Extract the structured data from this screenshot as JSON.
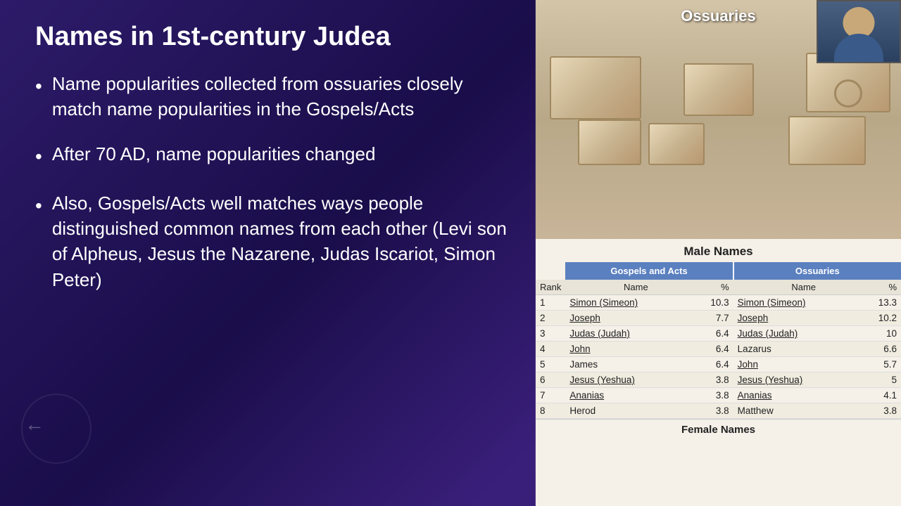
{
  "title": "Names in 1st-century Judea",
  "bullets": [
    "Name popularities collected from ossuaries closely match name popularities in the Gospels/Acts",
    "After 70 AD, name popularities changed",
    "Also, Gospels/Acts well matches ways people distinguished common names from each other (Levi son of Alpheus, Jesus the Nazarene, Judas Iscariot, Simon Peter)"
  ],
  "right": {
    "ossuaries_label": "Ossuaries",
    "table_title": "Male Names",
    "col_headers": {
      "gospels": "Gospels and Acts",
      "ossuaries": "Ossuaries"
    },
    "sub_headers": {
      "rank": "Rank",
      "name1": "Name",
      "pct1": "%",
      "name2": "Name",
      "pct2": "%"
    },
    "rows": [
      {
        "rank": "1",
        "name1": "Simon (Simeon)",
        "pct1": "10.3",
        "name2": "Simon (Simeon)",
        "pct2": "13.3",
        "underline1": true,
        "underline2": true
      },
      {
        "rank": "2",
        "name1": "Joseph",
        "pct1": "7.7",
        "name2": "Joseph",
        "pct2": "10.2",
        "underline1": true,
        "underline2": true
      },
      {
        "rank": "3",
        "name1": "Judas (Judah)",
        "pct1": "6.4",
        "name2": "Judas (Judah)",
        "pct2": "10",
        "underline1": true,
        "underline2": true
      },
      {
        "rank": "4",
        "name1": "John",
        "pct1": "6.4",
        "name2": "Lazarus",
        "pct2": "6.6",
        "underline1": true,
        "underline2": false
      },
      {
        "rank": "5",
        "name1": "James",
        "pct1": "6.4",
        "name2": "John",
        "pct2": "5.7",
        "underline1": false,
        "underline2": true
      },
      {
        "rank": "6",
        "name1": "Jesus (Yeshua)",
        "pct1": "3.8",
        "name2": "Jesus (Yeshua)",
        "pct2": "5",
        "underline1": true,
        "underline2": true
      },
      {
        "rank": "7",
        "name1": "Ananias",
        "pct1": "3.8",
        "name2": "Ananias",
        "pct2": "4.1",
        "underline1": true,
        "underline2": true
      },
      {
        "rank": "8",
        "name1": "Herod",
        "pct1": "3.8",
        "name2": "Matthew",
        "pct2": "3.8",
        "underline1": false,
        "underline2": false
      }
    ],
    "female_names_label": "Female Names"
  }
}
